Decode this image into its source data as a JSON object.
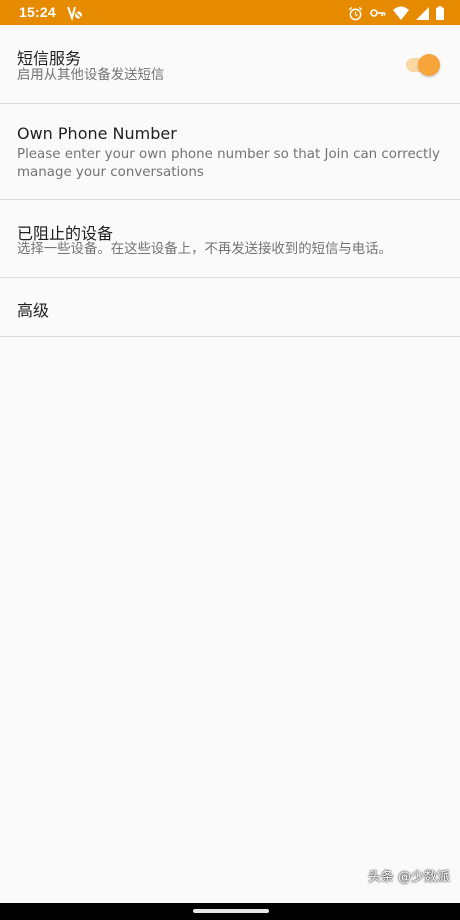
{
  "status_bar": {
    "time": "15:24",
    "background": "#e68a00",
    "icons": [
      "sim-no-signal-icon",
      "alarm-icon",
      "vpn-key-icon",
      "wifi-icon",
      "cell-signal-icon",
      "battery-icon"
    ]
  },
  "settings": {
    "sms_service": {
      "title": "短信服务",
      "summary": "启用从其他设备发送短信",
      "toggle_on": true,
      "accent_color": "#f7a53a"
    },
    "own_phone": {
      "title": "Own Phone Number",
      "summary_line1": "Please enter your own phone number so that Join can correctly",
      "summary_line2": "manage your conversations"
    },
    "blocked_devices": {
      "title": "已阻止的设备",
      "summary": "选择一些设备。在这些设备上，不再发送接收到的短信与电话。"
    },
    "advanced": {
      "title": "高级"
    }
  },
  "watermark": "头条 @少数派"
}
